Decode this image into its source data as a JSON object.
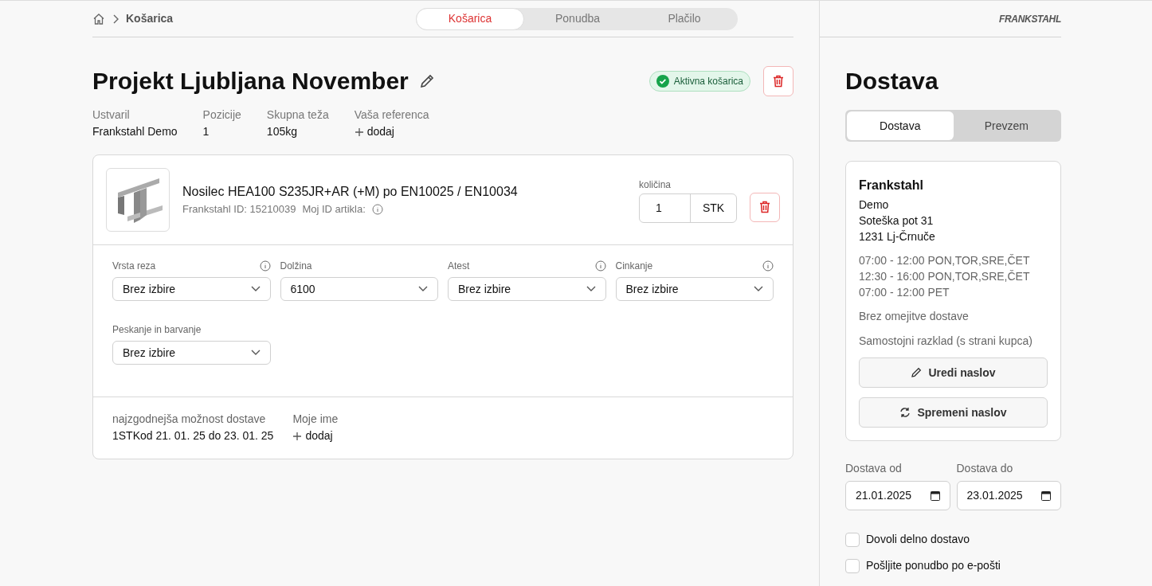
{
  "breadcrumb": {
    "current": "Košarica"
  },
  "steps": [
    {
      "label": "Košarica",
      "selected": true
    },
    {
      "label": "Ponudba",
      "selected": false
    },
    {
      "label": "Plačilo",
      "selected": false
    }
  ],
  "logo": "FRANKSTAHL",
  "cart": {
    "title": "Projekt Ljubljana November",
    "status": "Aktivna košarica",
    "meta": [
      {
        "label": "Ustvaril",
        "value": "Frankstahl Demo",
        "kind": "text"
      },
      {
        "label": "Pozicije",
        "value": "1",
        "kind": "text"
      },
      {
        "label": "Skupna teža",
        "value": "105kg",
        "kind": "text"
      },
      {
        "label": "Vaša referenca",
        "value": "dodaj",
        "kind": "add"
      }
    ]
  },
  "item": {
    "name": "Nosilec HEA100 S235JR+AR (+M) po EN10025 / EN10034",
    "id": "Frankstahl ID: 15210039",
    "my_id": "Moj ID artikla:",
    "quantity_label": "količina",
    "quantity": "1",
    "unit": "STK",
    "options": [
      {
        "label": "Vrsta reza",
        "value": "Brez izbire",
        "info": true
      },
      {
        "label": "Dolžina",
        "value": "6100",
        "info": false
      },
      {
        "label": "Atest",
        "value": "Brez izbire",
        "info": true
      },
      {
        "label": "Cinkanje",
        "value": "Brez izbire",
        "info": true
      },
      {
        "label": "Peskanje in barvanje",
        "value": "Brez izbire",
        "info": false
      }
    ],
    "footer": [
      {
        "label": "najzgodnejša možnost dostave",
        "value": "1STKod 21. 01. 25 do 23. 01. 25",
        "kind": "text"
      },
      {
        "label": "Moje ime",
        "value": "dodaj",
        "kind": "add"
      }
    ]
  },
  "delivery": {
    "title": "Dostava",
    "tabs": [
      {
        "label": "Dostava",
        "selected": true
      },
      {
        "label": "Prevzem",
        "selected": false
      }
    ],
    "address": {
      "company": "Frankstahl",
      "lines": [
        "Demo",
        "Soteška pot 31",
        "1231 Lj-Črnuče"
      ],
      "hours": [
        "07:00 - 12:00 PON,TOR,SRE,ČET",
        "12:30 - 16:00 PON,TOR,SRE,ČET",
        "07:00 - 12:00 PET"
      ],
      "notes": [
        "Brez omejitve dostave",
        "Samostojni razklad (s strani kupca)"
      ],
      "buttons": [
        {
          "label": "Uredi naslov",
          "kind": "edit"
        },
        {
          "label": "Spremeni naslov",
          "kind": "change"
        }
      ]
    },
    "dates": [
      {
        "label": "Dostava od",
        "value": "21.01.2025"
      },
      {
        "label": "Dostava do",
        "value": "23.01.2025"
      }
    ],
    "checkboxes": [
      {
        "label": "Dovoli delno dostavo",
        "checked": false
      },
      {
        "label": "Pošljite ponudbo po e-pošti",
        "checked": false
      }
    ]
  }
}
